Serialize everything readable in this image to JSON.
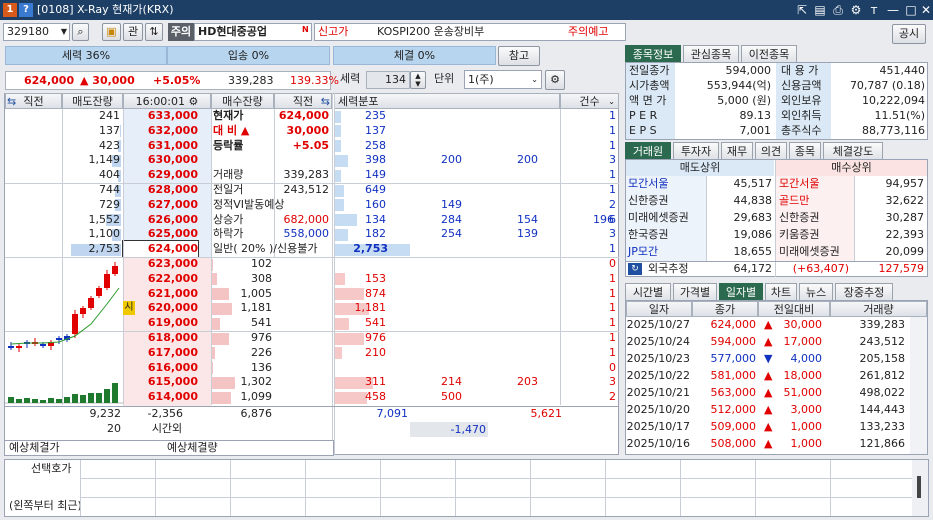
{
  "window": {
    "icon_badge": "1",
    "icon_badge2": "?",
    "title": "[0108] X-Ray 현재가(KRX)"
  },
  "code_bar": {
    "code": "329180",
    "gwan": "관",
    "ju": "주의",
    "name": "HD현대중공업",
    "n_badge": "N",
    "new_high": "신고가",
    "sector": "KOSPI200 운송장비부",
    "warning": "주의예고",
    "notice_btn": "공시"
  },
  "strength_row": {
    "seryuk": "세력 36%",
    "ipsong": "입송 0%",
    "chegyeol": "체결 0%",
    "ref_btn": "참고"
  },
  "price_row": {
    "price": "624,000",
    "change": "▲ 30,000",
    "rate": "+5.05%",
    "volume": "339,283",
    "vol_ratio": "139.33%"
  },
  "ctrl_row": {
    "seryuk_label": "세력",
    "seryuk_val": "134",
    "unit_label": "단위",
    "unit_val": "1(주)"
  },
  "ob_header": {
    "jikjeon_l": "직전",
    "sell_rem": "매도잔량",
    "time": "16:00:01",
    "buy_rem": "매수잔량",
    "jikjeon_r": "직전",
    "dist_header": "세력분포",
    "count_header": "건수"
  },
  "asks": [
    {
      "qty": "241",
      "price": "633,000",
      "dist": [
        "235",
        "",
        "",
        ""
      ],
      "cnt": "1",
      "bar": 0
    },
    {
      "qty": "137",
      "price": "632,000",
      "dist": [
        "137",
        "",
        "",
        ""
      ],
      "cnt": "1",
      "bar": 0.02
    },
    {
      "qty": "423",
      "price": "631,000",
      "dist": [
        "258",
        "",
        "",
        ""
      ],
      "cnt": "1",
      "bar": 0.05
    },
    {
      "qty": "1,149",
      "price": "630,000",
      "dist": [
        "398",
        "200",
        "200",
        ""
      ],
      "cnt": "3",
      "bar": 0.15
    },
    {
      "qty": "404",
      "price": "629,000",
      "dist": [
        "149",
        "",
        "",
        ""
      ],
      "cnt": "1",
      "bar": 0.05
    },
    {
      "qty": "744",
      "price": "628,000",
      "dist": [
        "649",
        "",
        "",
        ""
      ],
      "cnt": "1",
      "bar": 0.1
    },
    {
      "qty": "729",
      "price": "627,000",
      "dist": [
        "160",
        "149",
        "",
        ""
      ],
      "cnt": "2",
      "bar": 0.1
    },
    {
      "qty": "1,552",
      "price": "626,000",
      "dist": [
        "134",
        "284",
        "154",
        "196"
      ],
      "cnt": "6",
      "bar": 0.25
    },
    {
      "qty": "1,100",
      "price": "625,000",
      "dist": [
        "182",
        "254",
        "139",
        ""
      ],
      "cnt": "3",
      "bar": 0.15
    },
    {
      "qty": "2,753",
      "price": "624,000",
      "dist": [
        "2,753",
        "",
        "",
        ""
      ],
      "cnt": "1",
      "bar": 0.85
    }
  ],
  "bids": [
    {
      "price": "623,000",
      "qty": "102",
      "dist": [
        "",
        "",
        "",
        ""
      ],
      "cnt": "0",
      "bar": 0.03
    },
    {
      "price": "622,000",
      "qty": "308",
      "dist": [
        "153",
        "",
        "",
        ""
      ],
      "cnt": "1",
      "bar": 0.1
    },
    {
      "price": "621,000",
      "qty": "1,005",
      "dist": [
        "874",
        "",
        "",
        ""
      ],
      "cnt": "1",
      "bar": 0.3
    },
    {
      "price": "620,000",
      "qty": "1,181",
      "dist": [
        "1,181",
        "",
        "",
        ""
      ],
      "cnt": "1",
      "bar": 0.35
    },
    {
      "price": "619,000",
      "qty": "541",
      "dist": [
        "541",
        "",
        "",
        ""
      ],
      "cnt": "1",
      "bar": 0.15
    },
    {
      "price": "618,000",
      "qty": "976",
      "dist": [
        "976",
        "",
        "",
        ""
      ],
      "cnt": "1",
      "bar": 0.3
    },
    {
      "price": "617,000",
      "qty": "226",
      "dist": [
        "210",
        "",
        "",
        ""
      ],
      "cnt": "1",
      "bar": 0.07
    },
    {
      "price": "616,000",
      "qty": "136",
      "dist": [
        "",
        "",
        "",
        ""
      ],
      "cnt": "0",
      "bar": 0.04
    },
    {
      "price": "615,000",
      "qty": "1,302",
      "dist": [
        "311",
        "214",
        "203",
        ""
      ],
      "cnt": "3",
      "bar": 0.4
    },
    {
      "price": "614,000",
      "qty": "1,099",
      "dist": [
        "458",
        "500",
        "",
        ""
      ],
      "cnt": "2",
      "bar": 0.33
    }
  ],
  "info_mid": [
    {
      "label": "현재가",
      "value": "624,000",
      "cls": "red bold"
    },
    {
      "label": "대 비 ▲",
      "value": "30,000",
      "cls": "red bold"
    },
    {
      "label": "등락률",
      "value": "+5.05",
      "cls": "red bold"
    },
    {
      "label": "",
      "value": "",
      "cls": ""
    },
    {
      "label": "거래량",
      "value": "339,283",
      "cls": ""
    },
    {
      "label": "전일거",
      "value": "243,512",
      "cls": ""
    },
    {
      "label": "정적VI발동예상",
      "value": "",
      "cls": ""
    },
    {
      "label": "상승가",
      "value": "682,000",
      "cls": "red"
    },
    {
      "label": "하락가",
      "value": "558,000",
      "cls": "blue"
    },
    {
      "label": "일반( 20% )/신용불가",
      "value": "",
      "cls": ""
    }
  ],
  "si_badge": "시",
  "ob_totals": {
    "sell_total": "9,232",
    "diff": "-2,356",
    "buy_total": "6,876",
    "dist_sell": "7,091",
    "dist_buy": "5,621",
    "sell_after": "20",
    "after_label": "시간외",
    "dist_diff": "-1,470"
  },
  "expected": {
    "price_label": "예상체결가",
    "qty_label": "예상체결량"
  },
  "bottom": {
    "select_label": "선택호가",
    "note": "(왼쪽부터 최근)"
  },
  "right_tabs": [
    "종목정보",
    "관심종목",
    "이전종목"
  ],
  "stock_info": [
    {
      "l1": "전일종가",
      "v1": "594,000",
      "l2": "대 용 가",
      "v2": "451,440"
    },
    {
      "l1": "시가총액",
      "v1": "553,944(억)",
      "l2": "신용금액",
      "v2": "70,787  (0.18)"
    },
    {
      "l1": "액 면 가",
      "v1": "5,000 (원)",
      "l2": "외인보유",
      "v2": "10,222,094"
    },
    {
      "l1": "P E R",
      "v1": "89.13",
      "l2": "외인취득",
      "v2": "11.51(%)"
    },
    {
      "l1": "E P S",
      "v1": "7,001",
      "l2": "총주식수",
      "v2": "88,773,116"
    }
  ],
  "broker_tabs": [
    "거래원",
    "투자자",
    "재무",
    "의견",
    "종목",
    "체결강도"
  ],
  "broker_headers": {
    "sell": "매도상위",
    "buy": "매수상위"
  },
  "brokers": [
    {
      "sn": "모간서울",
      "sv": "45,517",
      "bn": "모간서울",
      "bv": "94,957",
      "sblue": true,
      "bred": true
    },
    {
      "sn": "신한증권",
      "sv": "44,838",
      "bn": "골드만",
      "bv": "32,622",
      "sblue": false,
      "bred": true
    },
    {
      "sn": "미래에셋증권",
      "sv": "29,683",
      "bn": "신한증권",
      "bv": "30,287",
      "sblue": false,
      "bred": false
    },
    {
      "sn": "한국증권",
      "sv": "19,086",
      "bn": "키움증권",
      "bv": "22,393",
      "sblue": false,
      "bred": false
    },
    {
      "sn": "JP모간",
      "sv": "18,655",
      "bn": "미래에셋증권",
      "bv": "20,099",
      "sblue": true,
      "bred": false
    }
  ],
  "foreign_est": {
    "label": "외국추정",
    "sell": "64,172",
    "net": "(+63,407)",
    "buy": "127,579"
  },
  "daily_tabs": [
    "시간별",
    "가격별",
    "일자별",
    "차트",
    "뉴스",
    "장중추정"
  ],
  "daily_headers": [
    "일자",
    "종가",
    "전일대비",
    "거래량"
  ],
  "daily": [
    {
      "date": "2025/10/27",
      "close": "624,000",
      "dir": "▲",
      "chg": "30,000",
      "vol": "339,283",
      "up": true
    },
    {
      "date": "2025/10/24",
      "close": "594,000",
      "dir": "▲",
      "chg": "17,000",
      "vol": "243,512",
      "up": true
    },
    {
      "date": "2025/10/23",
      "close": "577,000",
      "dir": "▼",
      "chg": "4,000",
      "vol": "205,158",
      "up": false
    },
    {
      "date": "2025/10/22",
      "close": "581,000",
      "dir": "▲",
      "chg": "18,000",
      "vol": "261,812",
      "up": true
    },
    {
      "date": "2025/10/21",
      "close": "563,000",
      "dir": "▲",
      "chg": "51,000",
      "vol": "498,022",
      "up": true
    },
    {
      "date": "2025/10/20",
      "close": "512,000",
      "dir": "▲",
      "chg": "3,000",
      "vol": "144,443",
      "up": true
    },
    {
      "date": "2025/10/17",
      "close": "509,000",
      "dir": "▲",
      "chg": "1,000",
      "vol": "133,233",
      "up": true
    },
    {
      "date": "2025/10/16",
      "close": "508,000",
      "dir": "▲",
      "chg": "1,000",
      "vol": "121,866",
      "up": true
    }
  ],
  "colors": {
    "up": "#e00000",
    "down": "#1030c0",
    "title_bg": "#1d3f66",
    "tab_active": "#2c6a4f"
  }
}
